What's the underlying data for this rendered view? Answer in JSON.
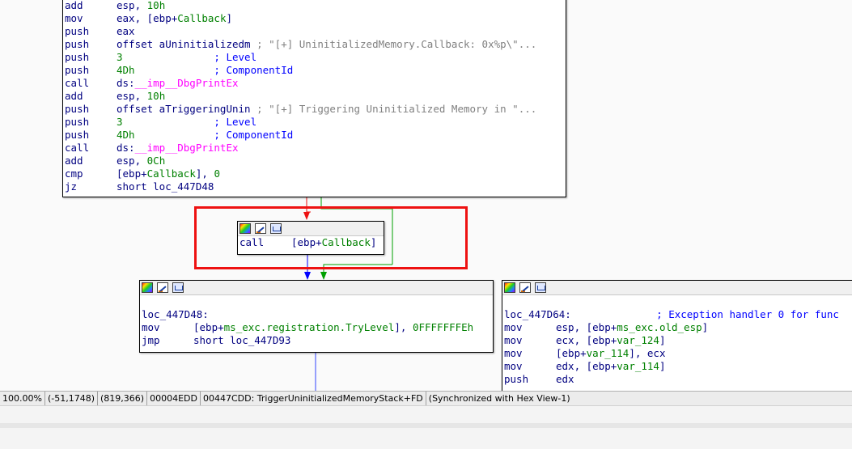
{
  "graph": {
    "top_block": {
      "lines": [
        {
          "mnem": "add",
          "ops": [
            {
              "t": "esp, ",
              "c": "dark"
            },
            {
              "t": "10h",
              "c": "num"
            }
          ]
        },
        {
          "mnem": "mov",
          "ops": [
            {
              "t": "eax, [ebp+",
              "c": "dark"
            },
            {
              "t": "Callback",
              "c": "name"
            },
            {
              "t": "]",
              "c": "dark"
            }
          ]
        },
        {
          "mnem": "push",
          "ops": [
            {
              "t": "eax",
              "c": "dark"
            }
          ]
        },
        {
          "mnem": "push",
          "ops": [
            {
              "t": "offset aUninitializedm ",
              "c": "dark"
            },
            {
              "t": "; \"[+] UninitializedMemory.Callback: 0x%p\\\"...",
              "c": "gray"
            }
          ]
        },
        {
          "mnem": "push",
          "ops": [
            {
              "t": "3",
              "c": "num"
            },
            {
              "t": "               ; ",
              "c": "blue"
            },
            {
              "t": "Level",
              "c": "blue"
            }
          ]
        },
        {
          "mnem": "push",
          "ops": [
            {
              "t": "4Dh",
              "c": "num"
            },
            {
              "t": "             ; ",
              "c": "blue"
            },
            {
              "t": "ComponentId",
              "c": "blue"
            }
          ]
        },
        {
          "mnem": "call",
          "ops": [
            {
              "t": "ds:",
              "c": "dark"
            },
            {
              "t": "__imp__DbgPrintEx",
              "c": "imp"
            }
          ]
        },
        {
          "mnem": "add",
          "ops": [
            {
              "t": "esp, ",
              "c": "dark"
            },
            {
              "t": "10h",
              "c": "num"
            }
          ]
        },
        {
          "mnem": "push",
          "ops": [
            {
              "t": "offset aTriggeringUnin ",
              "c": "dark"
            },
            {
              "t": "; \"[+] Triggering Uninitialized Memory in \"...",
              "c": "gray"
            }
          ]
        },
        {
          "mnem": "push",
          "ops": [
            {
              "t": "3",
              "c": "num"
            },
            {
              "t": "               ; ",
              "c": "blue"
            },
            {
              "t": "Level",
              "c": "blue"
            }
          ]
        },
        {
          "mnem": "push",
          "ops": [
            {
              "t": "4Dh",
              "c": "num"
            },
            {
              "t": "             ; ",
              "c": "blue"
            },
            {
              "t": "ComponentId",
              "c": "blue"
            }
          ]
        },
        {
          "mnem": "call",
          "ops": [
            {
              "t": "ds:",
              "c": "dark"
            },
            {
              "t": "__imp__DbgPrintEx",
              "c": "imp"
            }
          ]
        },
        {
          "mnem": "add",
          "ops": [
            {
              "t": "esp, ",
              "c": "dark"
            },
            {
              "t": "0Ch",
              "c": "num"
            }
          ]
        },
        {
          "mnem": "cmp",
          "ops": [
            {
              "t": "[ebp+",
              "c": "dark"
            },
            {
              "t": "Callback",
              "c": "name"
            },
            {
              "t": "], ",
              "c": "dark"
            },
            {
              "t": "0",
              "c": "num"
            }
          ]
        },
        {
          "mnem": "jz",
          "ops": [
            {
              "t": "short loc_447D48",
              "c": "dark"
            }
          ]
        }
      ]
    },
    "call_block": {
      "lines": [
        {
          "mnem": "call",
          "ops": [
            {
              "t": "[ebp+",
              "c": "dark"
            },
            {
              "t": "Callback",
              "c": "name"
            },
            {
              "t": "]",
              "c": "dark"
            }
          ]
        }
      ]
    },
    "left_block": {
      "lines": [
        {
          "mnem": "",
          "ops": []
        },
        {
          "mnem": "",
          "ops": [
            {
              "t": "loc_447D48:",
              "c": "dark"
            }
          ]
        },
        {
          "mnem": "mov",
          "ops": [
            {
              "t": "[ebp+",
              "c": "dark"
            },
            {
              "t": "ms_exc.registration.TryLevel",
              "c": "name"
            },
            {
              "t": "], ",
              "c": "dark"
            },
            {
              "t": "0FFFFFFFEh",
              "c": "num"
            }
          ]
        },
        {
          "mnem": "jmp",
          "ops": [
            {
              "t": "short loc_447D93",
              "c": "dark"
            }
          ]
        }
      ]
    },
    "right_block": {
      "lines": [
        {
          "mnem": "",
          "ops": []
        },
        {
          "mnem": "",
          "ops": [
            {
              "t": "loc_447D64:",
              "c": "dark"
            },
            {
              "t": "              ; Exception handler 0 for func",
              "c": "blue"
            }
          ]
        },
        {
          "mnem": "mov",
          "ops": [
            {
              "t": "esp, [ebp+",
              "c": "dark"
            },
            {
              "t": "ms_exc.old_esp",
              "c": "name"
            },
            {
              "t": "]",
              "c": "dark"
            }
          ]
        },
        {
          "mnem": "mov",
          "ops": [
            {
              "t": "ecx, [ebp+",
              "c": "dark"
            },
            {
              "t": "var_124",
              "c": "name"
            },
            {
              "t": "]",
              "c": "dark"
            }
          ]
        },
        {
          "mnem": "mov",
          "ops": [
            {
              "t": "[ebp+",
              "c": "dark"
            },
            {
              "t": "var_114",
              "c": "name"
            },
            {
              "t": "], ecx",
              "c": "dark"
            }
          ]
        },
        {
          "mnem": "mov",
          "ops": [
            {
              "t": "edx, [ebp+",
              "c": "dark"
            },
            {
              "t": "var_114",
              "c": "name"
            },
            {
              "t": "]",
              "c": "dark"
            }
          ]
        },
        {
          "mnem": "push",
          "ops": [
            {
              "t": "edx",
              "c": "dark"
            }
          ]
        }
      ]
    },
    "colors": {
      "edge_red": "#ee1111",
      "edge_green": "#00a000",
      "edge_blue": "#0000ff",
      "highlight_box": "#ee1111"
    }
  },
  "status_bar": {
    "zoom": "100.00%",
    "mouse_pos": "(-51,1748)",
    "graph_pos": "(819,366)",
    "file_offset": "00004EDD",
    "location": "00447CDD: TriggerUninitializedMemoryStack+FD",
    "sync": "(Synchronized with Hex View-1)"
  }
}
